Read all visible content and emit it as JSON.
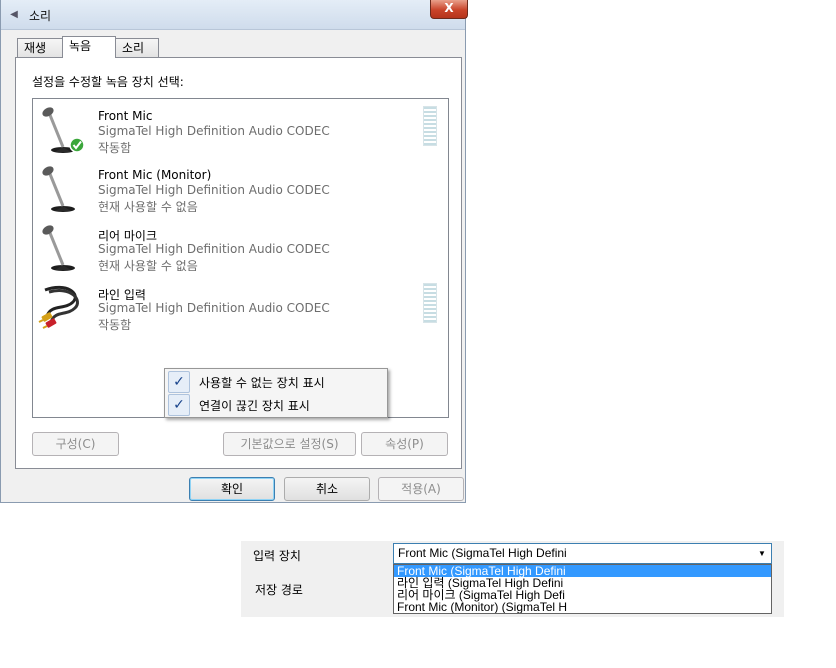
{
  "dialog": {
    "title": "소리",
    "close_label": "X",
    "tabs": [
      {
        "label": "재생"
      },
      {
        "label": "녹음"
      },
      {
        "label": "소리"
      }
    ],
    "instruction": "설정을 수정할 녹음 장치 선택:",
    "devices": [
      {
        "name": "Front Mic",
        "driver": "SigmaTel High Definition Audio CODEC",
        "status": "작동함",
        "icon": "microphone-icon-default-check",
        "meter": true
      },
      {
        "name": "Front Mic (Monitor)",
        "driver": "SigmaTel High Definition Audio CODEC",
        "status": "현재 사용할 수 없음",
        "icon": "microphone-icon",
        "meter": false
      },
      {
        "name": "리어 마이크",
        "driver": "SigmaTel High Definition Audio CODEC",
        "status": "현재 사용할 수 없음",
        "icon": "microphone-icon",
        "meter": false
      },
      {
        "name": "라인 입력",
        "driver": "SigmaTel High Definition Audio CODEC",
        "status": "작동함",
        "icon": "rca-cable-icon",
        "meter": true
      }
    ],
    "context_menu": [
      {
        "label": "사용할 수 없는 장치 표시",
        "checked": true,
        "check_glyph": "✓"
      },
      {
        "label": "연결이 끊긴 장치 표시",
        "checked": true,
        "check_glyph": "✓"
      }
    ],
    "buttons": {
      "configure": "구성(C)",
      "set_default": "기본값으로 설정(S)",
      "properties": "속성(P)",
      "ok": "확인",
      "cancel": "취소",
      "apply": "적용(A)"
    }
  },
  "settings": {
    "input_label": "입력 장치",
    "path_label": "저장 경로",
    "selected_value": "Front Mic (SigmaTel High Defini",
    "options": [
      "Front Mic (SigmaTel High Defini",
      "라인 입력 (SigmaTel High Defini",
      "리어 마이크 (SigmaTel High Defi",
      "Front Mic (Monitor) (SigmaTel H"
    ],
    "selected_index": 0
  },
  "colors": {
    "selection": "#3399ff",
    "check_green": "#3aa63a",
    "close_red": "#c9442a"
  }
}
